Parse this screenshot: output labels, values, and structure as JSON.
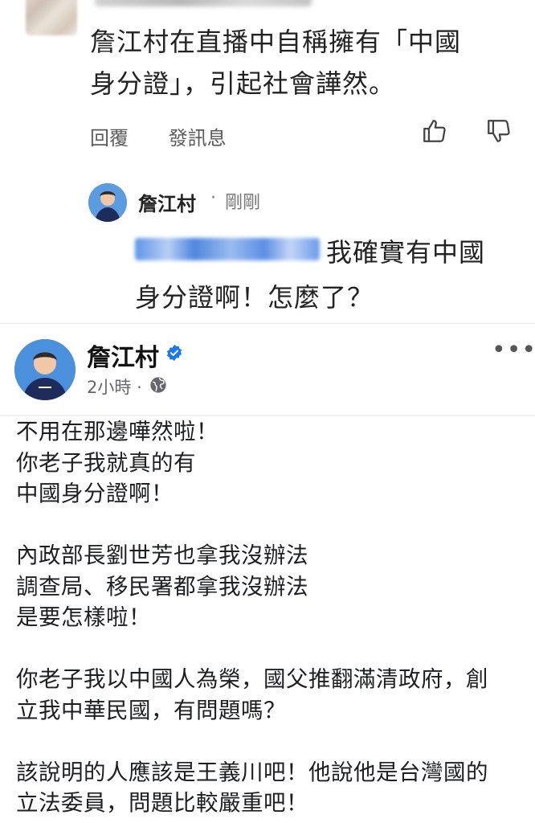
{
  "comment": {
    "line1": "詹江村在直播中自稱擁有「中國",
    "line2": "身分證」，引起社會譁然。",
    "reply_label": "回覆",
    "message_label": "發訊息"
  },
  "reply": {
    "author": "詹江村",
    "separator": "·",
    "time": "剛剛",
    "line1": "我確實有中國",
    "line2": "身分證啊！怎麼了？"
  },
  "post": {
    "author": "詹江村",
    "time": "2小時",
    "separator": "·",
    "more": "•••",
    "lines": [
      "不用在那邊嘩然啦！",
      "你老子我就真的有",
      "中國身分證啊！",
      "",
      "內政部長劉世芳也拿我沒辦法",
      "調查局、移民署都拿我沒辦法",
      "是要怎樣啦！",
      "",
      "你老子我以中國人為榮，國父推翻滿清政府，創",
      "立我中華民國，有問題嗎？",
      "",
      "該說明的人應該是王義川吧！他說他是台灣國的",
      "立法委員，問題比較嚴重吧！"
    ]
  },
  "colors": {
    "verified": "#1877f2",
    "secondary_text": "#65676b",
    "main_text": "#1c1e21"
  },
  "icons": [
    "like-icon",
    "dislike-icon",
    "verified-badge-icon",
    "globe-icon",
    "more-options-icon"
  ]
}
